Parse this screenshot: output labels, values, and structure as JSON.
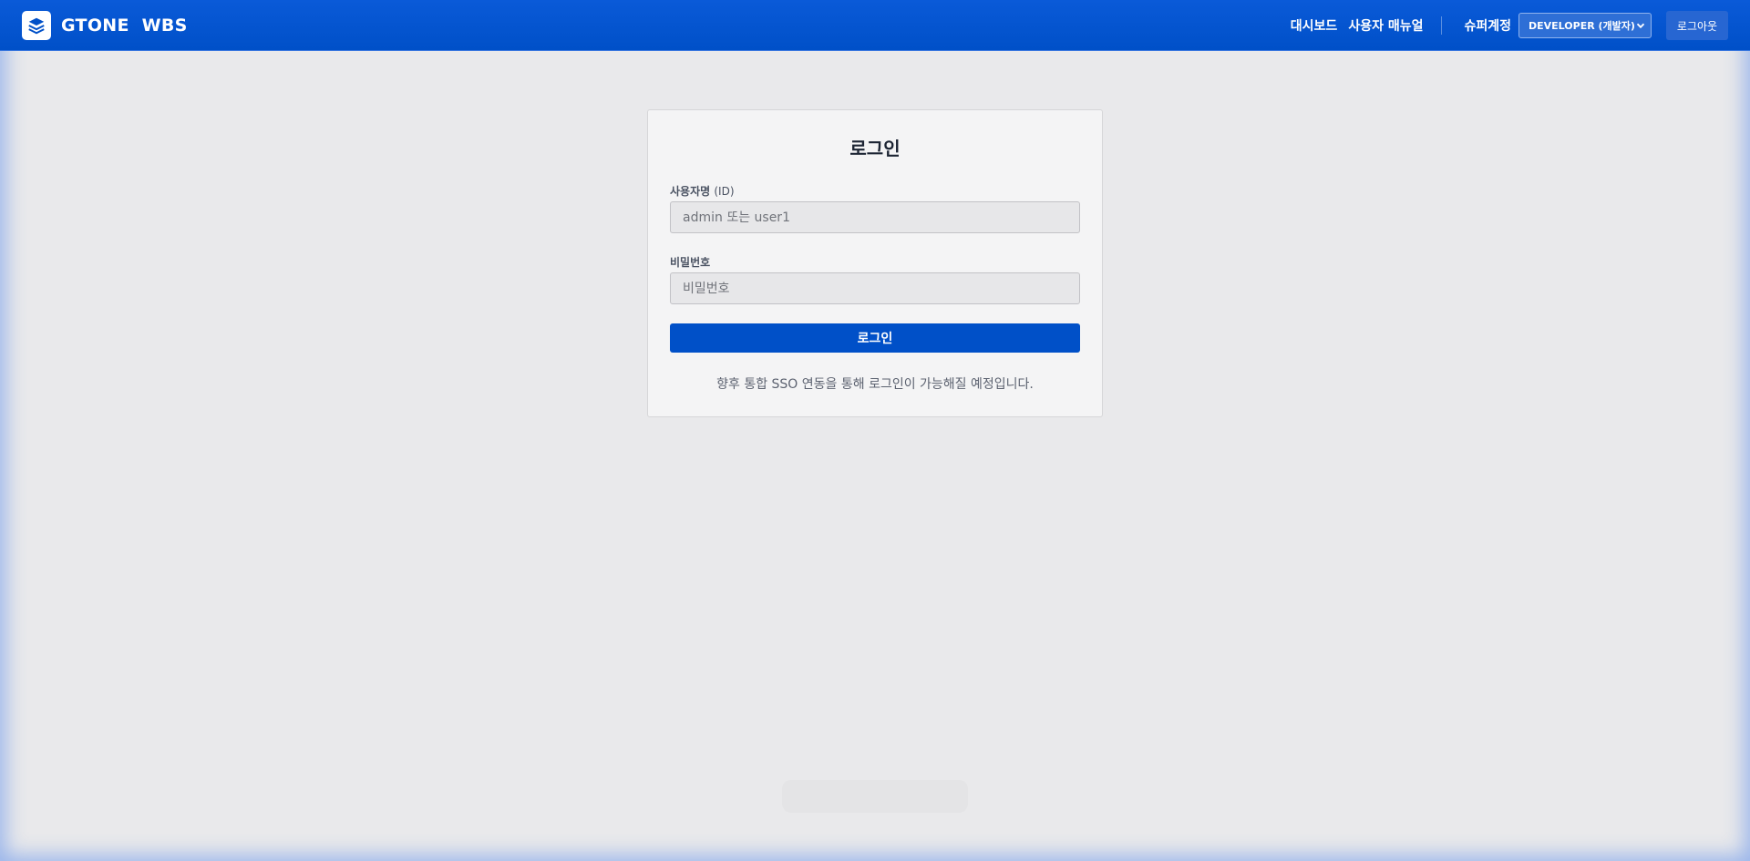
{
  "header": {
    "brand_name": "GTONE  WBS",
    "nav": {
      "dashboard": "대시보드",
      "user_manual": "사용자 매뉴얼"
    },
    "account_label": "슈퍼계정",
    "role_select": {
      "selected": "DEVELOPER (개발자)"
    },
    "logout_label": "로그아웃"
  },
  "login": {
    "title": "로그인",
    "username_label": "사용자명",
    "username_label_sub": "(ID)",
    "username_placeholder": "admin 또는 user1",
    "password_label": "비밀번호",
    "password_placeholder": "비밀번호",
    "submit_label": "로그인",
    "sso_note": "향후 통합 SSO 연동을 통해 로그인이 가능해질 예정입니다."
  },
  "colors": {
    "brand": "#0050c8",
    "background": "#e9e9eb",
    "card": "#f4f4f5"
  }
}
